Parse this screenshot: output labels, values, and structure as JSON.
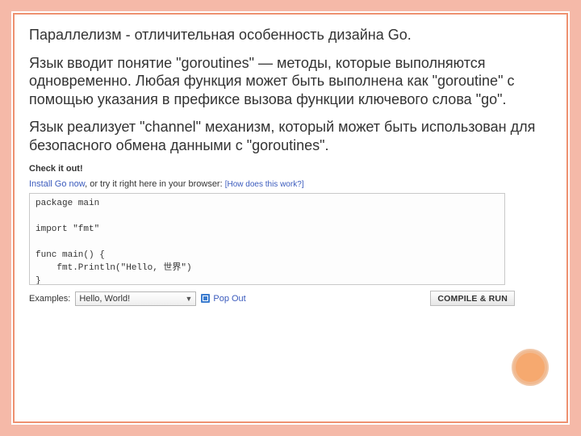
{
  "text": {
    "heading": "Параллелизм - отличительная особенность дизайна Go.",
    "para1": "Язык вводит понятие \"goroutines\" — методы, которые выполняются одновременно. Любая функция может быть выполнена как \"goroutine\" с помощью указания в префиксе вызова функции ключевого слова \"go\".",
    "para2": "Язык реализует \"channel\" механизм, который может быть использован для безопасного обмена данными с \"goroutines\"."
  },
  "playground": {
    "title": "Check it out!",
    "install_link": "Install Go now",
    "install_rest": ", or try it right here in your browser: ",
    "how_link": "[How does this work?]",
    "code": "package main\n\nimport \"fmt\"\n\nfunc main() {\n    fmt.Println(\"Hello, 世界\")\n}",
    "examples_label": "Examples:",
    "selected_example": "Hello, World!",
    "popout_label": "Pop Out",
    "compile_label": "COMPILE & RUN"
  }
}
